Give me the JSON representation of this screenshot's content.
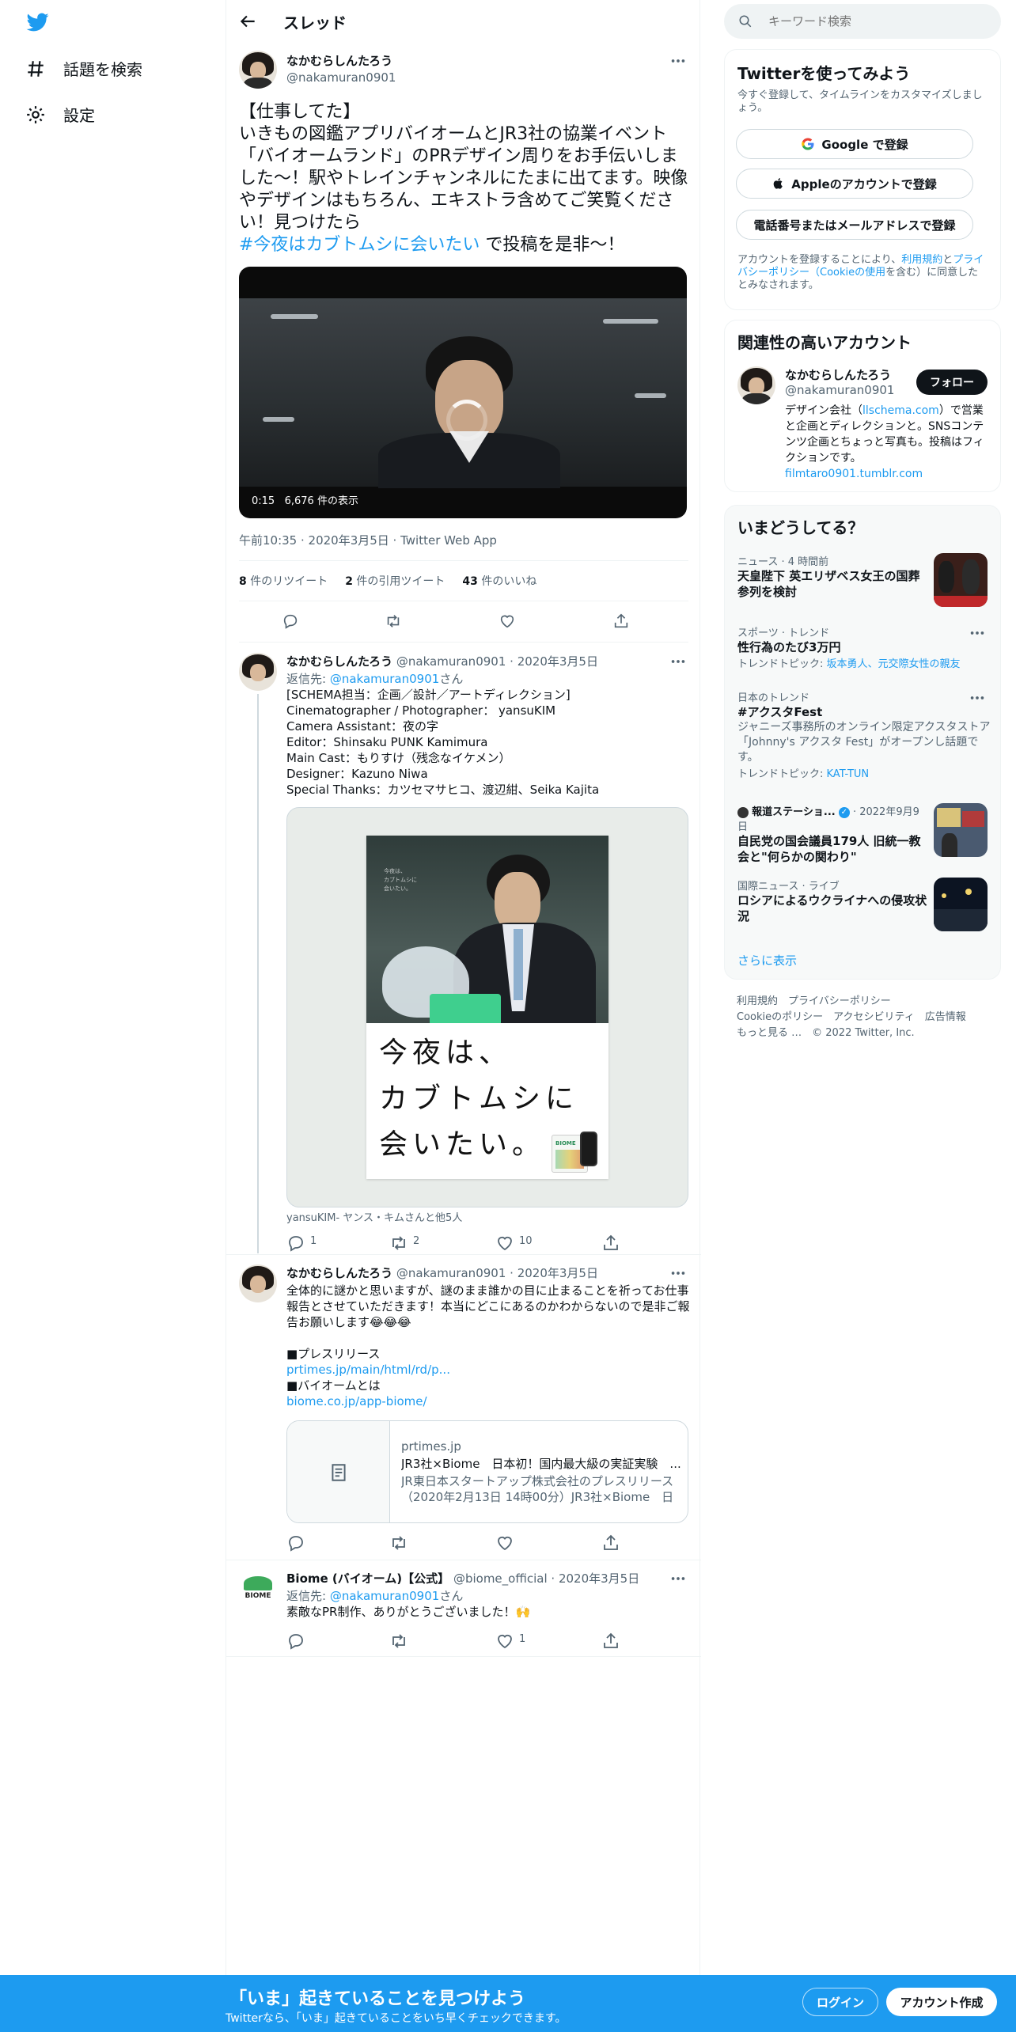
{
  "nav": {
    "search_label": "話題を検索",
    "settings_label": "設定"
  },
  "topbar": {
    "title": "スレッド"
  },
  "main_tweet": {
    "name": "なかむらしんたろう",
    "handle": "@nakamuran0901",
    "text": "【仕事してた】\nいきもの図鑑アプリバイオームとJR3社の協業イベント「バイオームランド」のPRデザイン周りをお手伝いしました〜！駅やトレインチャンネルにたまに出てます。映像やデザインはもちろん、エキストラ含めてご笑覧ください！見つけたら",
    "hashtag": "#今夜はカブトムシに会いたい",
    "text_end": " で投稿を是非〜！",
    "video_time": "0:15",
    "video_views": "6,676 件の表示",
    "meta": "午前10:35 · 2020年3月5日 · Twitter Web App",
    "retweets": "8",
    "retweets_label": " 件のリツイート",
    "quotes": "2",
    "quotes_label": " 件の引用ツイート",
    "likes": "43",
    "likes_label": " 件のいいね"
  },
  "reply1": {
    "name": "なかむらしんたろう",
    "handle": "@nakamuran0901",
    "date": "· 2020年3月5日",
    "reply_to_label": "返信先: ",
    "reply_to": "@nakamuran0901",
    "reply_to_suffix": "さん",
    "text": "[SCHEMA担当：企画／設計／アートディレクション]\nCinematographer / Photographer： yansuKIM\nCamera Assistant：夜の字\nEditor：Shinsaku PUNK Kamimura\nMain Cast：もりすけ（残念なイケメン）\nDesigner：Kazuno Niwa\nSpecial Thanks：カツセマサヒコ、渡辺紺、Seika Kajita",
    "poster_small": "今夜は、\nカブトムシに\n会いたい。",
    "poster_headline": "今夜は、\nカブトムシに\n会いたい。",
    "poster_app_label": "BIOME",
    "tagged": "yansuKIM- ヤンス・キムさんと他5人",
    "replies": "1",
    "retweets": "2",
    "likes": "10"
  },
  "reply2": {
    "name": "なかむらしんたろう",
    "handle": "@nakamuran0901",
    "date": "· 2020年3月5日",
    "text": "全体的に謎かと思いますが、謎のまま誰かの目に止まることを祈ってお仕事報告とさせていただきます！本当にどこにあるのかわからないので是非ご報告お願いします😂😂😂\n\n■プレスリリース",
    "link1": "prtimes.jp/main/html/rd/p...",
    "text2": "■バイオームとは",
    "link2": "biome.co.jp/app-biome/",
    "card_domain": "prtimes.jp",
    "card_title": "JR3社×Biome　日本初！国内最大級の実証実験　...",
    "card_desc": "JR東日本スタートアップ株式会社のプレスリリース（2020年2月13日 14時00分）JR3社×Biome　日本..."
  },
  "reply3": {
    "name": "Biome (バイオーム)【公式】",
    "handle": "@biome_official",
    "date": "· 2020年3月5日",
    "reply_to_label": "返信先: ",
    "reply_to": "@nakamuran0901",
    "reply_to_suffix": "さん",
    "text": "素敵なPR制作、ありがとうございました！🙌",
    "avatar_label": "BIOME",
    "likes": "1"
  },
  "search": {
    "placeholder": "キーワード検索"
  },
  "signup": {
    "title": "Twitterを使ってみよう",
    "subtitle": "今すぐ登録して、タイムラインをカスタマイズしましょう。",
    "google": "Google で登録",
    "apple": "Appleのアカウントで登録",
    "phone": "電話番号またはメールアドレスで登録",
    "legal_1": "アカウントを登録することにより、",
    "legal_terms": "利用規約",
    "legal_2": "と",
    "legal_privacy": "プライバシーポリシー（Cookieの使用",
    "legal_3": "を含む）に同意したとみなされます。"
  },
  "related": {
    "title": "関連性の高いアカウント",
    "name": "なかむらしんたろう",
    "handle": "@nakamuran0901",
    "follow": "フォロー",
    "bio_1": "デザイン会社（",
    "bio_link": "llschema.com",
    "bio_2": "）で営業と企画とディレクションと。SNSコンテンツ企画とちょっと写真も。投稿はフィクションです。",
    "bio_link2": "filmtaro0901.tumblr.com"
  },
  "trends": {
    "title": "いまどうしてる？",
    "items": [
      {
        "cat": "ニュース · 4 時間前",
        "title": "天皇陛下 英エリザベス女王の国葬参列を検討"
      },
      {
        "cat": "スポーツ · トレンド",
        "title": "性行為のたび3万円",
        "extra": "トレンドトピック: ",
        "extra_link": "坂本勇人、元交際女性の親友"
      },
      {
        "cat": "日本のトレンド",
        "title": "#アクスタFest",
        "desc": "ジャニーズ事務所のオンライン限定アクスタストア「Johnny's アクスタ Fest」がオープンし話題です。",
        "extra": "トレンドトピック: ",
        "extra_link": "KAT-TUN"
      },
      {
        "cat": "報道ステーショ...",
        "cat_date": "· 2022年9月9日",
        "title": "自民党の国会議員179人 旧統一教会と\"何らかの関わり\""
      },
      {
        "cat": "国際ニュース · ライブ",
        "title": "ロシアによるウクライナへの侵攻状況"
      }
    ],
    "more": "さらに表示"
  },
  "footer": {
    "line1": "利用規約　プライバシーポリシー",
    "line2": "Cookieのポリシー　アクセシビリティ　広告情報",
    "line3": "もっと見る …　© 2022 Twitter, Inc."
  },
  "bottombar": {
    "title": "「いま」起きていることを見つけよう",
    "subtitle": "Twitterなら、「いま」起きていることをいち早くチェックできます。",
    "login": "ログイン",
    "signup": "アカウント作成"
  },
  "colors": {
    "accent": "#1d9bf0",
    "text": "#0f1419",
    "muted": "#536471",
    "border": "#eff3f4"
  }
}
